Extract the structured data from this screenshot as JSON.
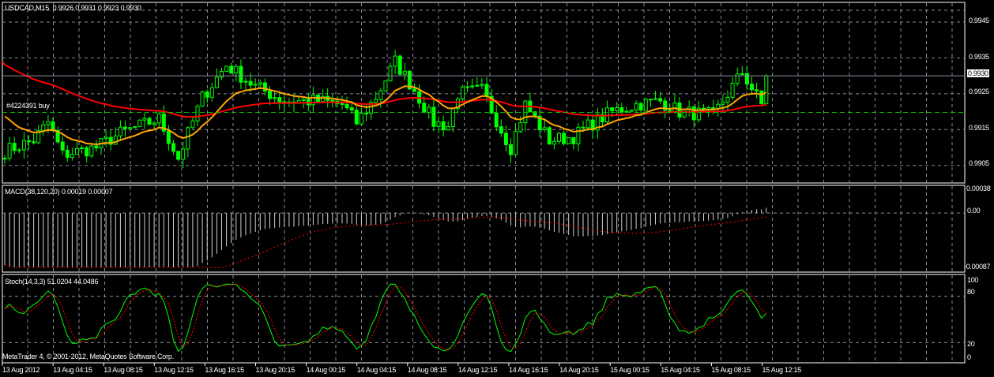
{
  "main": {
    "symbol_label": "USDCAD,M15",
    "ohlc": "0.9926 0.9931 0.9923 0.9930",
    "order_label": "#4224391 buy",
    "order_price": 0.99198,
    "current_price": "0.9930",
    "price_ticks": [
      "0.9945",
      "0.9935",
      "0.9925",
      "0.9915",
      "0.9905"
    ],
    "price_range": [
      0.99001,
      0.99505
    ],
    "bar_count": 159,
    "close_keypoints": [
      [
        0,
        0.9909
      ],
      [
        6,
        0.9912
      ],
      [
        9,
        0.9917
      ],
      [
        12,
        0.9908
      ],
      [
        19,
        0.991
      ],
      [
        24,
        0.9914
      ],
      [
        32,
        0.9918
      ],
      [
        36,
        0.9907
      ],
      [
        41,
        0.9924
      ],
      [
        46,
        0.9933
      ],
      [
        52,
        0.9927
      ],
      [
        58,
        0.9923
      ],
      [
        65,
        0.9923
      ],
      [
        70,
        0.9922
      ],
      [
        73,
        0.9917
      ],
      [
        77,
        0.9924
      ],
      [
        81,
        0.9934
      ],
      [
        85,
        0.9926
      ],
      [
        89,
        0.9917
      ],
      [
        92,
        0.9916
      ],
      [
        94,
        0.9925
      ],
      [
        99,
        0.9926
      ],
      [
        103,
        0.9915
      ],
      [
        105,
        0.991
      ],
      [
        108,
        0.9922
      ],
      [
        113,
        0.9912
      ],
      [
        118,
        0.9913
      ],
      [
        121,
        0.9916
      ],
      [
        126,
        0.992
      ],
      [
        131,
        0.9922
      ],
      [
        136,
        0.9923
      ],
      [
        140,
        0.992
      ],
      [
        147,
        0.9919
      ],
      [
        150,
        0.9925
      ],
      [
        153,
        0.9931
      ],
      [
        157,
        0.9922
      ],
      [
        158,
        0.993
      ]
    ],
    "colors": {
      "candles": "#00ff00",
      "ma_slow": "#ff0000",
      "ma_fast": "#ffa500",
      "order_line": "#00c000",
      "grid": "#8a8a9a"
    }
  },
  "macd": {
    "label": "MACD(38,120,20) 0.00019 0.00007",
    "ticks": [
      "0.00038",
      "0.00",
      "-0.00087"
    ],
    "range": [
      -0.00087,
      0.00038
    ]
  },
  "stoch": {
    "label": "Stoch(14,3,3) 51.0204 44.0486",
    "ticks": [
      "100",
      "80",
      "20",
      "0"
    ]
  },
  "footer": {
    "copyright": "MetaTrader 4, © 2001-2012, MetaQuotes Software Corp."
  },
  "time_axis": [
    "13 Aug 2012",
    "13 Aug 04:15",
    "13 Aug 08:15",
    "13 Aug 12:15",
    "13 Aug 16:15",
    "13 Aug 20:15",
    "14 Aug 00:15",
    "14 Aug 04:15",
    "14 Aug 08:15",
    "14 Aug 12:15",
    "14 Aug 16:15",
    "14 Aug 20:15",
    "15 Aug 00:15",
    "15 Aug 04:15",
    "15 Aug 08:15",
    "15 Aug 12:15"
  ]
}
